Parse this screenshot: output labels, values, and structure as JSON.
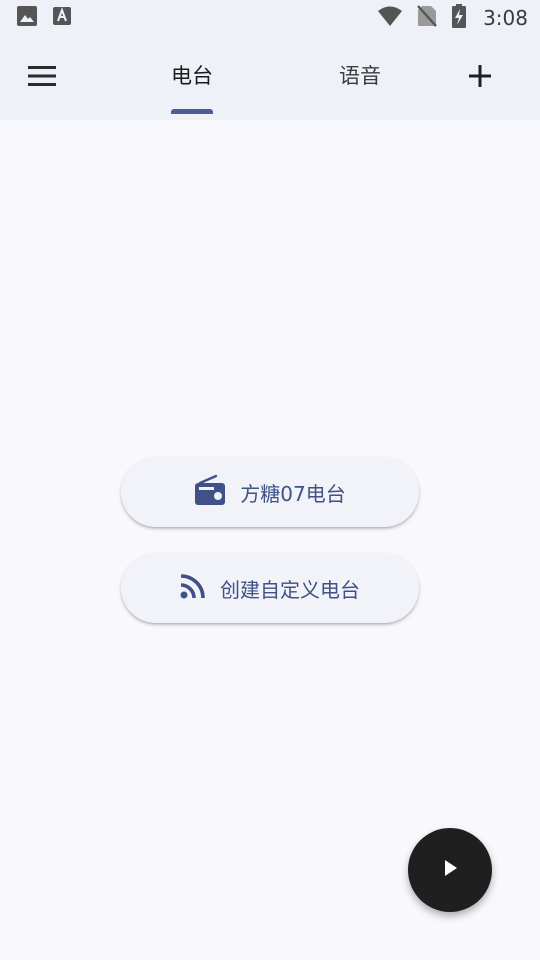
{
  "status_bar": {
    "time": "3:08",
    "icons": [
      "image-icon",
      "font-icon",
      "wifi-icon",
      "no-sim-icon",
      "battery-charging-icon"
    ]
  },
  "app_bar": {
    "tabs": [
      {
        "label": "电台",
        "selected": true
      },
      {
        "label": "语音",
        "selected": false
      }
    ],
    "menu_icon": "menu-icon",
    "add_icon": "add-icon"
  },
  "main": {
    "buttons": [
      {
        "label": "方糖07电台",
        "icon": "radio-icon"
      },
      {
        "label": "创建自定义电台",
        "icon": "rss-icon"
      }
    ]
  },
  "fab": {
    "icon": "play-icon"
  },
  "colors": {
    "accent": "#4a5e95",
    "button_text": "#3f5186",
    "app_bar_bg": "#eef1f8",
    "page_bg": "#f8f8fd",
    "fab_bg": "#1f1f1f"
  }
}
